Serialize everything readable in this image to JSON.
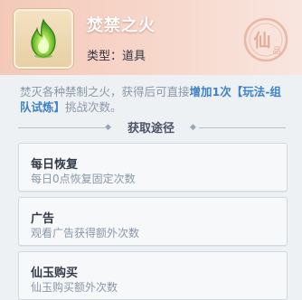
{
  "item": {
    "name": "焚禁之火",
    "type_label": "类型：",
    "type_value": "道具",
    "grade_text": "仙",
    "grade_sub_text": "品",
    "icon": "green-flame-icon"
  },
  "description": {
    "text_before": "焚灭各种禁制之火，获得后可直接",
    "highlight": "增加1次【玩法-组队试炼】",
    "text_after": "挑战次数。"
  },
  "section": {
    "title": "获取途径"
  },
  "sources": [
    {
      "title": "每日恢复",
      "subtitle": "每日0点恢复固定次数"
    },
    {
      "title": "广告",
      "subtitle": "观看广告获得额外次数"
    },
    {
      "title": "仙玉购买",
      "subtitle": "仙玉购买额外次数"
    }
  ],
  "colors": {
    "header_gradient_start": "#f4c9b9",
    "highlight_text": "#3e82c8",
    "muted_text": "#8a97a8"
  }
}
